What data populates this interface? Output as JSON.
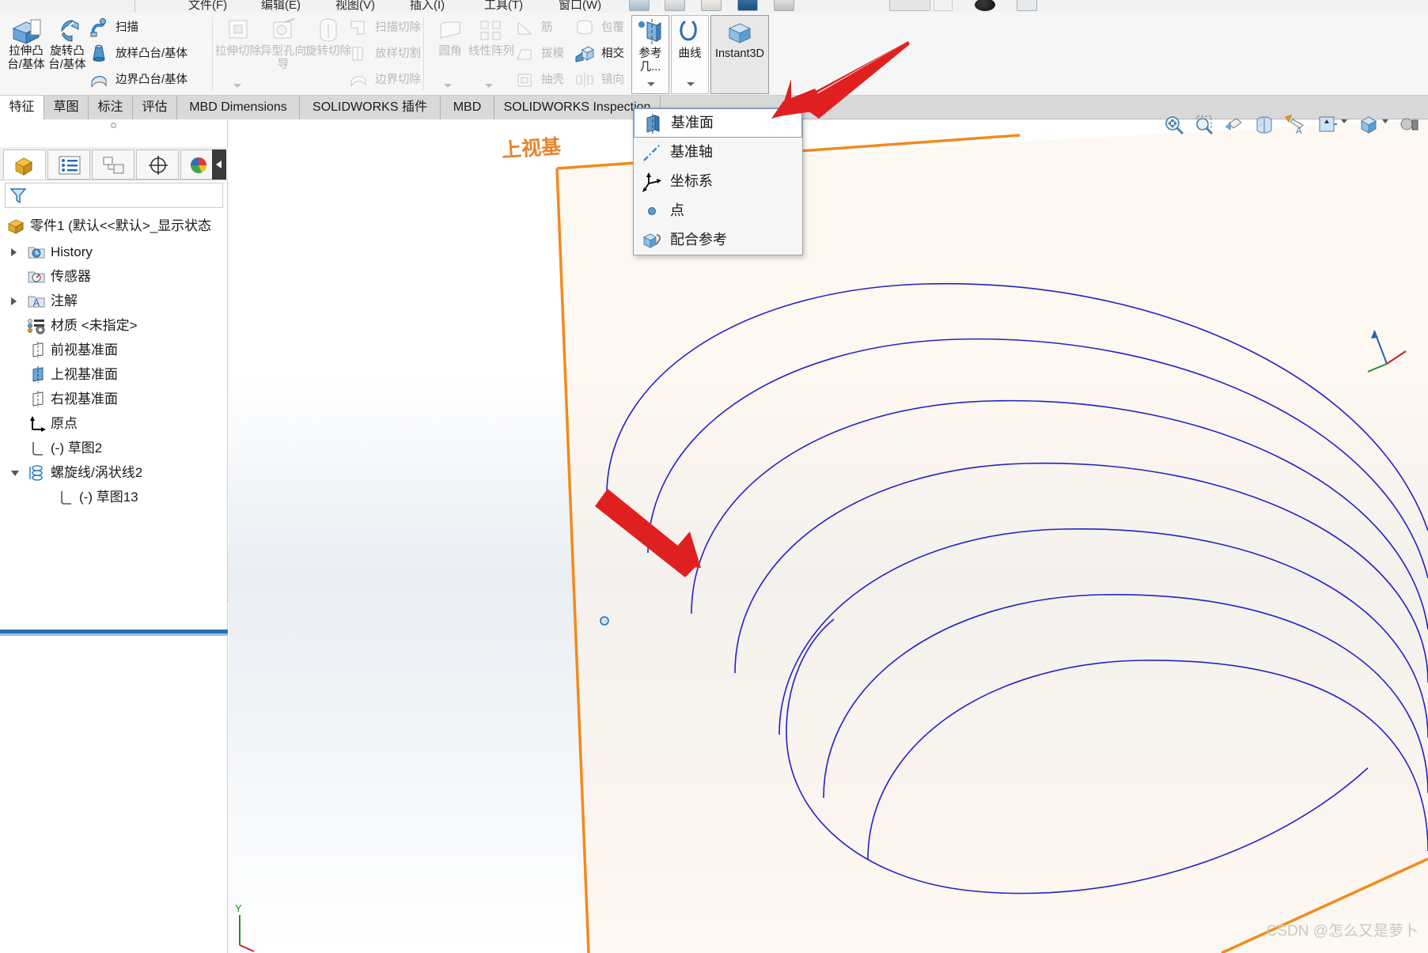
{
  "window": {
    "menu_items": [
      "文件(F)",
      "编辑(E)",
      "视图(V)",
      "插入(I)",
      "工具(T)",
      "窗口(W)"
    ]
  },
  "ribbon": {
    "groups": [
      {
        "name": "features-group",
        "big_buttons": [
          {
            "label": "拉伸凸台/基体",
            "icon": "extrude-boss-icon",
            "enabled": true
          },
          {
            "label": "旋转凸台/基体",
            "icon": "revolve-boss-icon",
            "enabled": true
          }
        ],
        "small_buttons": [
          {
            "label": "扫描",
            "icon": "sweep-icon",
            "enabled": true
          },
          {
            "label": "放样凸台/基体",
            "icon": "loft-boss-icon",
            "enabled": true
          },
          {
            "label": "边界凸台/基体",
            "icon": "boundary-boss-icon",
            "enabled": true
          }
        ]
      },
      {
        "name": "cut-group",
        "big_buttons": [
          {
            "label": "拉伸切除",
            "icon": "extrude-cut-icon",
            "enabled": false
          },
          {
            "label": "异型孔向导",
            "icon": "hole-wizard-icon",
            "enabled": false
          },
          {
            "label": "旋转切除",
            "icon": "revolve-cut-icon",
            "enabled": false
          }
        ],
        "small_buttons": [
          {
            "label": "扫描切除",
            "icon": "sweep-cut-icon",
            "enabled": false
          },
          {
            "label": "放样切割",
            "icon": "loft-cut-icon",
            "enabled": false
          },
          {
            "label": "边界切除",
            "icon": "boundary-cut-icon",
            "enabled": false
          }
        ]
      },
      {
        "name": "modify-group",
        "big_buttons": [
          {
            "label": "圆角",
            "icon": "fillet-icon",
            "enabled": false
          },
          {
            "label": "线性阵列",
            "icon": "linear-pattern-icon",
            "enabled": false
          }
        ],
        "small_buttons": [
          {
            "label": "筋",
            "icon": "rib-icon",
            "enabled": false
          },
          {
            "label": "拔模",
            "icon": "draft-icon",
            "enabled": false
          },
          {
            "label": "抽壳",
            "icon": "shell-icon",
            "enabled": false
          }
        ]
      },
      {
        "name": "surface-group",
        "small_buttons": [
          {
            "label": "包覆",
            "icon": "wrap-icon",
            "enabled": false
          },
          {
            "label": "相交",
            "icon": "intersect-icon",
            "enabled": true
          },
          {
            "label": "镜向",
            "icon": "mirror-icon",
            "enabled": false
          }
        ]
      },
      {
        "name": "reference-group",
        "framed_buttons": [
          {
            "label": "参考几...",
            "icon": "reference-geometry-icon",
            "active": true,
            "has_caret": true
          },
          {
            "label": "曲线",
            "icon": "curves-icon",
            "active": false,
            "has_caret": true
          },
          {
            "label": "Instant3D",
            "icon": "instant3d-icon",
            "active": true,
            "has_caret": false
          }
        ]
      }
    ]
  },
  "tabs": [
    {
      "label": "特征",
      "active": true
    },
    {
      "label": "草图",
      "active": false
    },
    {
      "label": "标注",
      "active": false
    },
    {
      "label": "评估",
      "active": false
    },
    {
      "label": "MBD Dimensions",
      "active": false
    },
    {
      "label": "SOLIDWORKS 插件",
      "active": false
    },
    {
      "label": "MBD",
      "active": false
    },
    {
      "label": "SOLIDWORKS Inspection",
      "active": false
    }
  ],
  "reference_dropdown": {
    "items": [
      {
        "label": "基准面",
        "icon": "plane-icon",
        "selected": true
      },
      {
        "label": "基准轴",
        "icon": "axis-icon",
        "selected": false
      },
      {
        "label": "坐标系",
        "icon": "coordinate-system-icon",
        "selected": false
      },
      {
        "label": "点",
        "icon": "point-icon",
        "selected": false
      },
      {
        "label": "配合参考",
        "icon": "mate-reference-icon",
        "selected": false
      }
    ]
  },
  "left_panel": {
    "manager_tabs": [
      {
        "name": "featuremanager-tab",
        "icon": "feature-tree-icon",
        "active": true
      },
      {
        "name": "propertymanager-tab",
        "icon": "property-list-icon",
        "active": false
      },
      {
        "name": "configurationmanager-tab",
        "icon": "configuration-icon",
        "active": false
      },
      {
        "name": "dimxpertmanager-tab",
        "icon": "dimxpert-icon",
        "active": false
      },
      {
        "name": "displaymanager-tab",
        "icon": "appearance-sphere-icon",
        "active": false
      }
    ],
    "filter_placeholder": "",
    "tree": [
      {
        "label": "零件1  (默认<<默认>_显示状态",
        "icon": "part-icon",
        "indent": 0,
        "arrow": "none",
        "truncated": true
      },
      {
        "label": "History",
        "icon": "history-folder-icon",
        "indent": 1,
        "arrow": "right"
      },
      {
        "label": "传感器",
        "icon": "sensors-icon",
        "indent": 1,
        "arrow": "none"
      },
      {
        "label": "注解",
        "icon": "annotations-folder-icon",
        "indent": 1,
        "arrow": "right"
      },
      {
        "label": "材质 <未指定>",
        "icon": "material-icon",
        "indent": 1,
        "arrow": "none"
      },
      {
        "label": "前视基准面",
        "icon": "plane-front-icon",
        "indent": 1,
        "arrow": "none"
      },
      {
        "label": "上视基准面",
        "icon": "plane-top-icon",
        "indent": 1,
        "arrow": "none"
      },
      {
        "label": "右视基准面",
        "icon": "plane-right-icon",
        "indent": 1,
        "arrow": "none"
      },
      {
        "label": "原点",
        "icon": "origin-icon",
        "indent": 1,
        "arrow": "none"
      },
      {
        "label": "(-) 草图2",
        "icon": "sketch-icon",
        "indent": 1,
        "arrow": "none"
      },
      {
        "label": "螺旋线/涡状线2",
        "icon": "helix-icon",
        "indent": 0,
        "arrow": "down"
      },
      {
        "label": "(-) 草图13",
        "icon": "sketch-icon",
        "indent": 2,
        "arrow": "none"
      }
    ]
  },
  "graphics": {
    "plane_label": "上视基",
    "view_toolbar": [
      {
        "name": "zoom-to-fit-icon",
        "caret": false
      },
      {
        "name": "zoom-to-area-icon",
        "caret": false
      },
      {
        "name": "previous-view-icon",
        "caret": false
      },
      {
        "name": "section-view-icon",
        "caret": false
      },
      {
        "name": "view-orientation-icon",
        "caret": false
      },
      {
        "name": "display-style-icon",
        "caret": true
      },
      {
        "name": "hide-show-items-icon",
        "caret": true
      },
      {
        "name": "edit-appearance-icon",
        "caret": true
      },
      {
        "name": "apply-scene-icon",
        "caret": true
      },
      {
        "name": "view-settings-icon",
        "caret": false
      }
    ],
    "annotations": {
      "arrow_to_menu": "red-arrow-pointing-to-reference-geometry",
      "arrow_to_point": "red-arrow-pointing-to-sketch-point"
    }
  },
  "watermark": "CSDN @怎么又是萝卜",
  "colors": {
    "accent_orange": "#e8822a",
    "curve_blue": "#2828c8",
    "arrow_red": "#e02020",
    "tree_selection": "#2a6fb5",
    "ribbon_bg": "#f6f6f6",
    "tab_bar_bg": "#d9d9d9"
  }
}
